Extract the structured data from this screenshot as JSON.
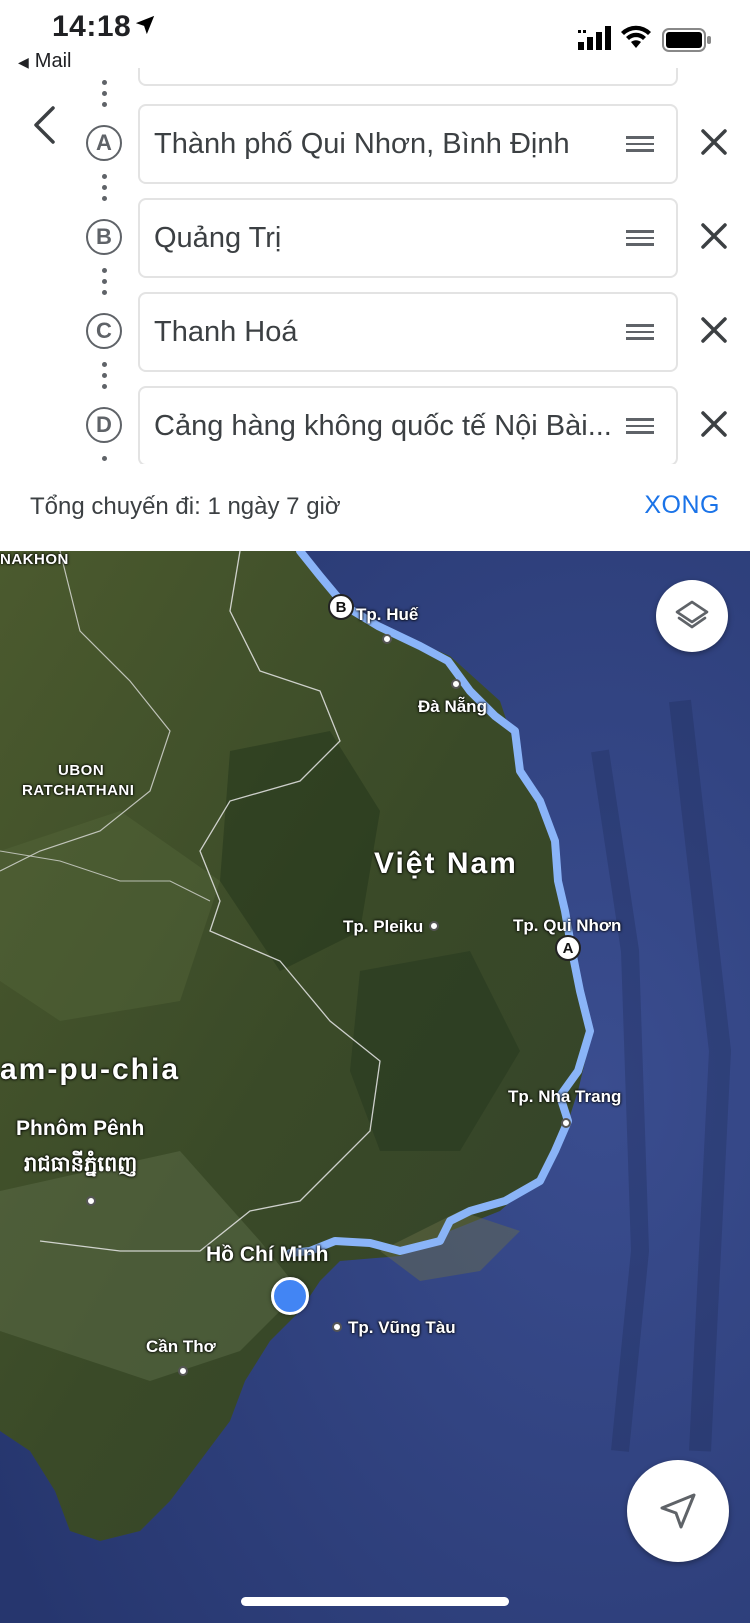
{
  "status_bar": {
    "time": "14:18",
    "back_app": "Mail",
    "icons": [
      "location-arrow-icon",
      "cellular-signal-icon",
      "wifi-icon",
      "battery-icon"
    ]
  },
  "header": {
    "back_icon": "chevron-left-icon"
  },
  "stops": [
    {
      "marker": "A",
      "value": "Thành phố Qui Nhơn, Bình Định"
    },
    {
      "marker": "B",
      "value": "Quảng Trị"
    },
    {
      "marker": "C",
      "value": "Thanh Hoá"
    },
    {
      "marker": "D",
      "value": "Cảng hàng không quốc tế Nội Bài..."
    }
  ],
  "summary": {
    "total": "Tổng chuyến đi: 1 ngày 7 giờ",
    "done": "XONG"
  },
  "map": {
    "labels": {
      "nakhon": "NAKHON",
      "hue": "Tp. Huế",
      "da_nang": "Đà Nẵng",
      "ubon_1": "UBON",
      "ubon_2": "RATCHATHANI",
      "viet_nam": "Việt Nam",
      "pleiku": "Tp. Pleiku",
      "qui_nhon": "Tp. Qui Nhơn",
      "cam_pu_chia": "am-pu-chia",
      "phnom_penh": "Phnôm Pênh",
      "phnom_penh_khmer": "រាជធានីភ្នំពេញ",
      "nha_trang": "Tp. Nha Trang",
      "hcm": "Hồ Chí Minh",
      "vung_tau": "Tp. Vũng Tàu",
      "can_tho": "Cần Thơ"
    },
    "pins": {
      "a": "A",
      "b": "B"
    },
    "route_color": "#8ab4f8",
    "location_color": "#4285f4"
  }
}
